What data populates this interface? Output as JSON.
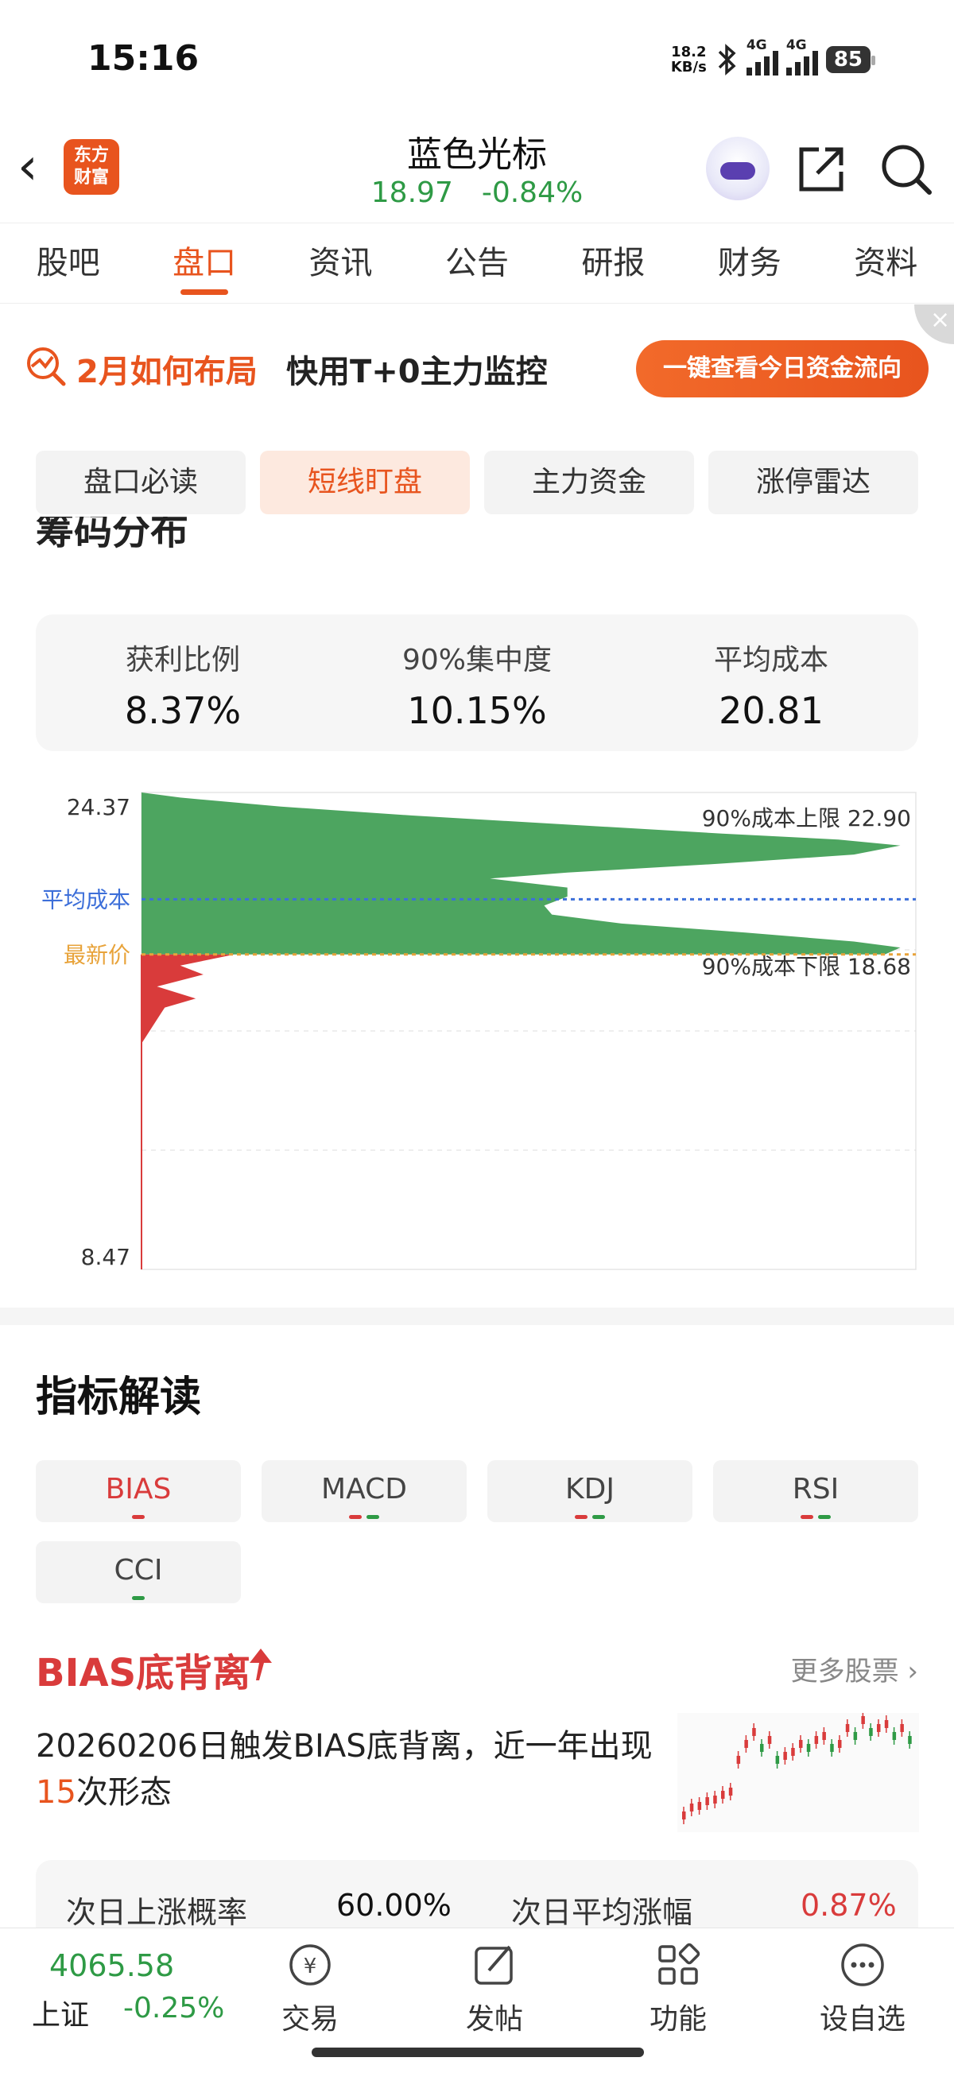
{
  "status": {
    "time": "15:16",
    "net_speed": "18.2",
    "net_unit": "KB/s",
    "sig1": "4G",
    "sig2": "4G",
    "battery": "85"
  },
  "header": {
    "logo": "东方财富",
    "title": "蓝色光标",
    "price": "18.97",
    "change": "-0.84%"
  },
  "tabs": [
    "股吧",
    "盘口",
    "资讯",
    "公告",
    "研报",
    "财务",
    "资料"
  ],
  "banner": {
    "text1": "2月如何布局",
    "text2": "快用T+0主力监控",
    "button": "一键查看今日资金流向",
    "close": "×"
  },
  "subtabs": [
    "盘口必读",
    "短线盯盘",
    "主力资金",
    "涨停雷达"
  ],
  "chip": {
    "section_title": "筹码分布",
    "stats": [
      {
        "label": "获利比例",
        "value": "8.37%"
      },
      {
        "label": "90%集中度",
        "value": "10.15%"
      },
      {
        "label": "平均成本",
        "value": "20.81"
      }
    ]
  },
  "chart_data": {
    "type": "area",
    "title": "",
    "ylim": [
      8.47,
      24.37
    ],
    "y_top_label": "24.37",
    "y_bottom_label": "8.47",
    "avg_cost_label": "平均成本",
    "latest_label": "最新价",
    "avg_cost": 20.81,
    "latest_price": 18.97,
    "upper_label": "90%成本上限 22.90",
    "lower_label": "90%成本下限 18.68",
    "upper": 22.9,
    "lower": 18.68,
    "profit_series": {
      "name": "",
      "color": "#d93b3b",
      "points": [
        [
          18.97,
          0.12
        ],
        [
          18.6,
          0.05
        ],
        [
          18.3,
          0.08
        ],
        [
          17.9,
          0.02
        ],
        [
          17.5,
          0.07
        ],
        [
          17.2,
          0.03
        ],
        [
          16.8,
          0.02
        ],
        [
          16.0,
          0.0
        ]
      ]
    },
    "loss_series": {
      "name": "",
      "color": "#4da560",
      "points": [
        [
          24.37,
          0.0
        ],
        [
          24.2,
          0.05
        ],
        [
          23.9,
          0.18
        ],
        [
          23.6,
          0.35
        ],
        [
          23.3,
          0.55
        ],
        [
          23.0,
          0.75
        ],
        [
          22.8,
          0.9
        ],
        [
          22.6,
          0.98
        ],
        [
          22.3,
          0.92
        ],
        [
          22.0,
          0.75
        ],
        [
          21.7,
          0.55
        ],
        [
          21.5,
          0.45
        ],
        [
          21.2,
          0.55
        ],
        [
          20.9,
          0.55
        ],
        [
          20.6,
          0.52
        ],
        [
          20.3,
          0.53
        ],
        [
          20.0,
          0.62
        ],
        [
          19.7,
          0.78
        ],
        [
          19.4,
          0.92
        ],
        [
          19.2,
          0.98
        ],
        [
          18.97,
          0.96
        ]
      ]
    }
  },
  "indicators": {
    "title": "指标解读",
    "tabs": [
      "BIAS",
      "MACD",
      "KDJ",
      "RSI",
      "CCI"
    ],
    "signal": {
      "title": "BIAS底背离",
      "more": "更多股票",
      "desc_pre": "20260206日触发BIAS底背离，近一年出现",
      "count": "15",
      "desc_post": "次形态"
    },
    "stats": [
      {
        "label": "次日上涨概率",
        "value": "60.00%"
      },
      {
        "label": "次日平均涨幅",
        "value": "0.87%"
      }
    ]
  },
  "bottom": {
    "index_value": "4065.58",
    "index_name": "上证",
    "index_change": "-0.25%",
    "nav": [
      "交易",
      "发帖",
      "功能",
      "设自选"
    ]
  },
  "colors": {
    "accent": "#e8541e",
    "up": "#d93b3b",
    "down": "#2e9a45"
  }
}
